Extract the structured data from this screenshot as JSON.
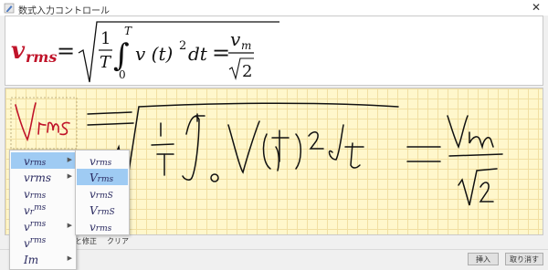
{
  "window": {
    "title": "数式入力コントロール",
    "close_icon": "close-icon"
  },
  "preview": {
    "lhs_base": "v",
    "lhs_sub": "rms",
    "equals": "=",
    "frac_num": "1",
    "frac_den": "T",
    "int_upper": "T",
    "int_lower": "0",
    "integrand": "v (t)",
    "power": "2",
    "dt": "dt",
    "equals2": "=",
    "rhs_num_base": "v",
    "rhs_num_sub": "m",
    "rhs_den": "2",
    "lhs_color": "#c0142a"
  },
  "canvas": {
    "ink_color": "#111111",
    "selection_ink_color": "#c0142a"
  },
  "menu_main": {
    "items": [
      {
        "base": "v",
        "sub": "rms",
        "sup": "",
        "has_sub": true,
        "selected": true
      },
      {
        "base": "vrms",
        "sub": "",
        "sup": "",
        "has_sub": true,
        "selected": false
      },
      {
        "base": "v",
        "sub": "rms",
        "sup": "",
        "has_sub": false,
        "selected": false
      },
      {
        "base": "v",
        "sub": "r",
        "sup": "ms",
        "has_sub": false,
        "selected": false
      },
      {
        "base": "v",
        "sub": "",
        "sup": "rms",
        "has_sub": true,
        "selected": false
      },
      {
        "base": "v",
        "sub": "",
        "sup": "rms",
        "has_sub": false,
        "selected": false
      },
      {
        "base": "Im",
        "sub": "",
        "sup": "",
        "has_sub": true,
        "selected": false
      }
    ]
  },
  "menu_sub": {
    "items": [
      {
        "base": "v",
        "sub": "rms"
      },
      {
        "base": "V",
        "sub": "rms"
      },
      {
        "base": "v",
        "sub": "rmS"
      },
      {
        "base": "V",
        "sub": "rmS"
      },
      {
        "base": "v",
        "sub": "rms"
      }
    ]
  },
  "toolbar": {
    "correct_label": "と修正",
    "clear_label": "クリア"
  },
  "buttons": {
    "insert_label": "挿入",
    "cancel_label": "取り消す"
  }
}
